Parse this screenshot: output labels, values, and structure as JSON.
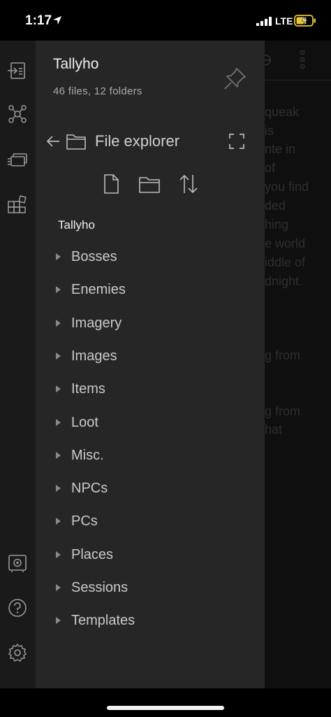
{
  "status_bar": {
    "time": "1:17",
    "network": "LTE",
    "icons": [
      "location-arrow-icon",
      "signal-bars-icon",
      "battery-charging-icon"
    ]
  },
  "left_rail": {
    "icons": [
      "open-quick-switcher-icon",
      "graph-view-icon",
      "slides-icon",
      "community-plugins-icon",
      "vault-icon",
      "help-icon",
      "settings-icon"
    ]
  },
  "drawer": {
    "vault_title": "Tallyho",
    "vault_stats": "46 files, 12 folders",
    "pin_icon": "pin-icon",
    "explorer_title": "File explorer",
    "actions": [
      "new-note-icon",
      "new-folder-icon",
      "sort-icon"
    ],
    "root_label": "Tallyho",
    "folders": [
      {
        "label": "Bosses"
      },
      {
        "label": "Enemies"
      },
      {
        "label": "Imagery"
      },
      {
        "label": "Images"
      },
      {
        "label": "Items"
      },
      {
        "label": "Loot"
      },
      {
        "label": "Misc."
      },
      {
        "label": "NPCs"
      },
      {
        "label": "PCs"
      },
      {
        "label": "Places"
      },
      {
        "label": "Sessions"
      },
      {
        "label": "Templates"
      }
    ]
  },
  "background_note": {
    "lines": [
      "queak",
      "is",
      "nte in",
      "of",
      "you find",
      "ded",
      "hing",
      "e world",
      "iddle of",
      "dnight."
    ],
    "line2": "g from",
    "line3a": "g from",
    "line3b": "hat"
  },
  "colors": {
    "drawer_bg": "#262626",
    "rail_bg": "#1a1a1a",
    "text_primary": "#f0f0f0",
    "text_secondary": "#aaaaaa"
  }
}
